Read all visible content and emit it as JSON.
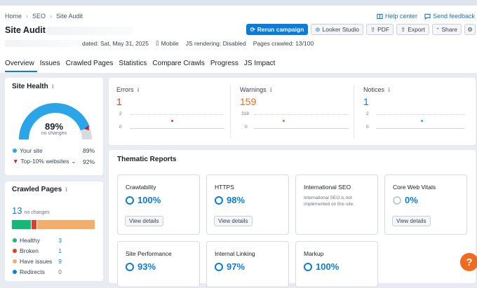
{
  "breadcrumb": [
    "Home",
    "SEO",
    "Site Audit"
  ],
  "top_links": {
    "help": "Help center",
    "feedback": "Send feedback"
  },
  "title": "Site Audit:",
  "buttons": {
    "rerun": "Rerun campaign",
    "looker": "Looker Studio",
    "pdf": "PDF",
    "export": "Export",
    "share": "Share"
  },
  "meta": {
    "updated": "dated: Sat, May 31, 2025",
    "device": "Mobile",
    "js": "JS rendering: Disabled",
    "crawled": "Pages crawled: 13/100"
  },
  "tabs": [
    "Overview",
    "Issues",
    "Crawled Pages",
    "Statistics",
    "Compare Crawls",
    "Progress",
    "JS Impact"
  ],
  "site_health": {
    "title": "Site Health",
    "score": "89%",
    "score_value": 89,
    "sub": "no changes",
    "your_site_label": "Your site",
    "your_site_value": "89%",
    "top10_label": "Top-10% websites",
    "top10_value": "92%"
  },
  "crawled_pages": {
    "title": "Crawled Pages",
    "count": "13",
    "sub": "no changes",
    "bar_fractions": {
      "healthy": 3,
      "broken": 1,
      "issues": 9
    },
    "items": [
      {
        "label": "Healthy",
        "value": "3",
        "color": "#18b87a"
      },
      {
        "label": "Broken",
        "value": "1",
        "color": "#e23c2f"
      },
      {
        "label": "Have issues",
        "value": "9",
        "color": "#f4ae6c"
      },
      {
        "label": "Redirects",
        "value": "0",
        "color": "#0a7cde"
      }
    ]
  },
  "metrics": {
    "errors": {
      "label": "Errors",
      "value": "1",
      "ymax": "2",
      "ymin": "0"
    },
    "warnings": {
      "label": "Warnings",
      "value": "159",
      "ymax": "318",
      "ymin": "0"
    },
    "notices": {
      "label": "Notices",
      "value": "1",
      "ymax": "2",
      "ymin": "0"
    }
  },
  "thematic": {
    "title": "Thematic Reports",
    "view_details": "View details",
    "reports": [
      {
        "name": "Crawlability",
        "value": "100%"
      },
      {
        "name": "HTTPS",
        "value": "98%"
      },
      {
        "name": "International SEO",
        "note": "International SEO is not implemented on this site."
      },
      {
        "name": "Core Web Vitals",
        "value": "0%"
      },
      {
        "name": "Site Performance",
        "value": "93%"
      },
      {
        "name": "Internal Linking",
        "value": "97%"
      },
      {
        "name": "Markup",
        "value": "100%"
      }
    ]
  },
  "help_bubble": "?",
  "colors": {
    "accent": "#0a7cde",
    "error": "#e23c2f",
    "warning": "#f06b1d",
    "notice": "#0a7cde"
  }
}
